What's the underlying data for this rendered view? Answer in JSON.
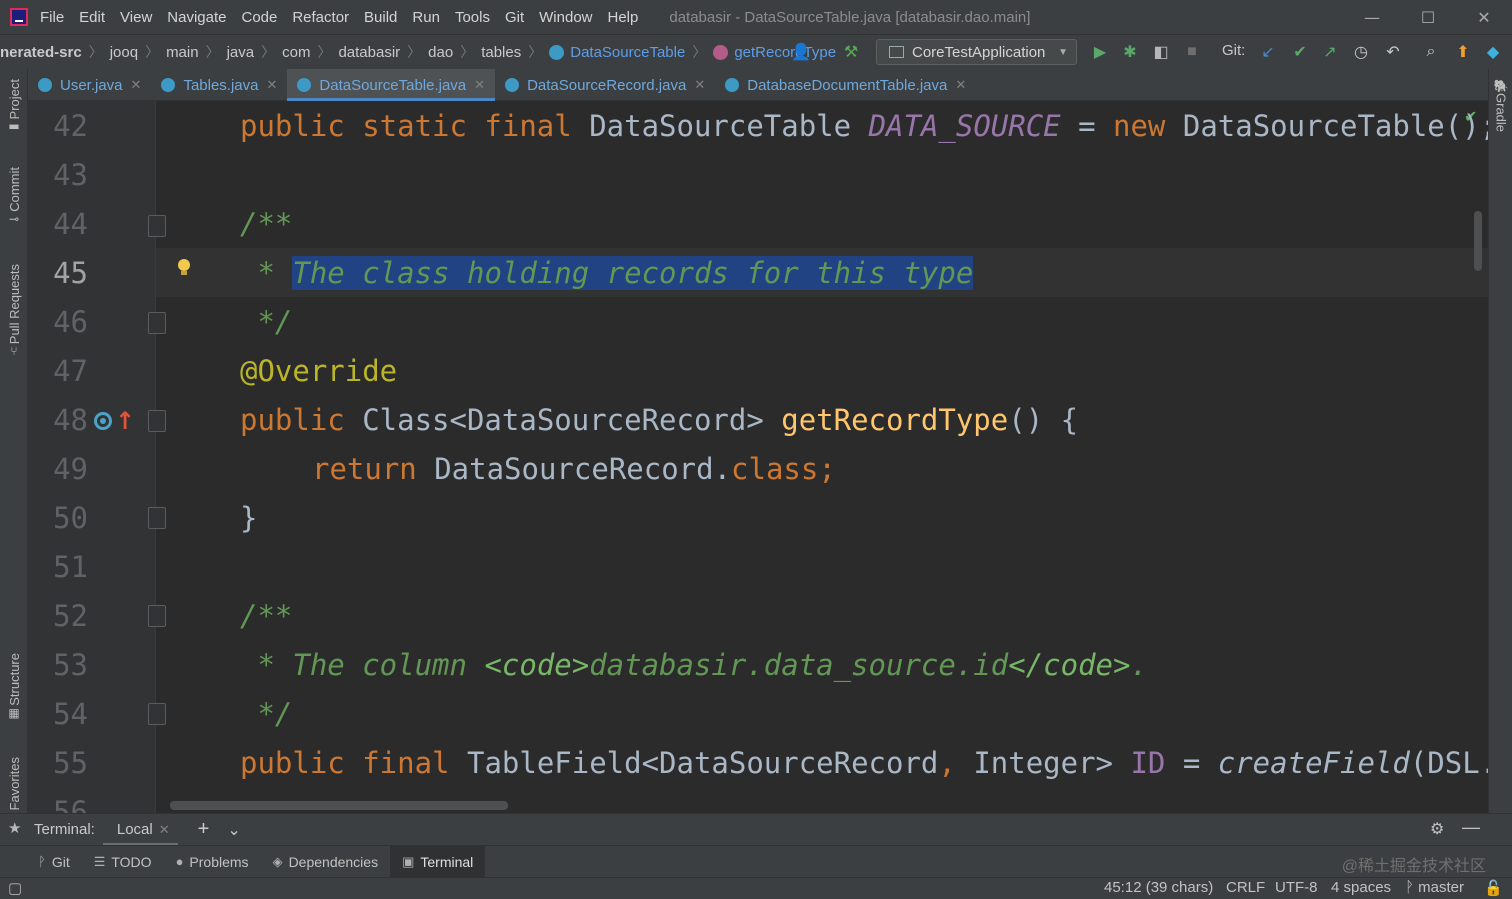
{
  "window": {
    "title": "databasir - DataSourceTable.java [databasir.dao.main]",
    "menu": [
      "File",
      "Edit",
      "View",
      "Navigate",
      "Code",
      "Refactor",
      "Build",
      "Run",
      "Tools",
      "Git",
      "Window",
      "Help"
    ],
    "controls": {
      "minimize": "—",
      "maximize": "☐",
      "close": "✕"
    }
  },
  "breadcrumb": {
    "items": [
      "nerated-src",
      "jooq",
      "main",
      "java",
      "com",
      "databasir",
      "dao",
      "tables"
    ],
    "class_name": "DataSourceTable",
    "method_name": "getRecordType"
  },
  "toolbar": {
    "run_config": "CoreTestApplication",
    "git_label": "Git:"
  },
  "tabs": [
    {
      "label": "User.java",
      "active": false
    },
    {
      "label": "Tables.java",
      "active": false
    },
    {
      "label": "DataSourceTable.java",
      "active": true
    },
    {
      "label": "DataSourceRecord.java",
      "active": false
    },
    {
      "label": "DatabaseDocumentTable.java",
      "active": false
    }
  ],
  "left_tools": [
    "Project",
    "Commit",
    "Pull Requests",
    "Structure",
    "Favorites"
  ],
  "right_tools": [
    "Gradle"
  ],
  "editor": {
    "line_numbers": [
      "42",
      "43",
      "44",
      "45",
      "46",
      "47",
      "48",
      "49",
      "50",
      "51",
      "52",
      "53",
      "54",
      "55",
      "56"
    ],
    "current_line": "45",
    "lines": {
      "l42": {
        "kw1": "public static final ",
        "type": "DataSourceTable ",
        "field": "DATA_SOURCE",
        "op": " = ",
        "kw2": "new ",
        "rest": "DataSourceTable();"
      },
      "l44": {
        "comment": "/**"
      },
      "l45": {
        "star": " * ",
        "selected": "The class holding records for this type"
      },
      "l46": {
        "comment": " */"
      },
      "l47": {
        "annotation": "@Override"
      },
      "l48": {
        "kw": "public ",
        "type": "Class<DataSourceRecord> ",
        "method": "getRecordType",
        "rest": "() {"
      },
      "l49": {
        "kw": "return ",
        "type": "DataSourceRecord.",
        "kw2": "class",
        "semi": ";"
      },
      "l50": {
        "text": "}"
      },
      "l52": {
        "comment": "/**"
      },
      "l53": {
        "star": " * The column ",
        "tag_open": "<code>",
        "tag_text": "databasir.data_source.id",
        "tag_close": "</code>",
        "end": "."
      },
      "l54": {
        "comment": " */"
      },
      "l55": {
        "kw": "public final ",
        "type": "TableField<DataSourceRecord",
        "comma": ", ",
        "type2": "Integer> ",
        "field": "ID",
        "op": " = ",
        "call": "createField",
        "rest": "(DSL.name(\"id\")"
      }
    }
  },
  "terminal": {
    "label": "Terminal:",
    "tab": "Local",
    "add": "+",
    "dropdown": "⌄"
  },
  "bottom_tools": [
    {
      "icon": "ᚹ",
      "label": "Git"
    },
    {
      "icon": "☰",
      "label": "TODO"
    },
    {
      "icon": "●",
      "label": "Problems"
    },
    {
      "icon": "◈",
      "label": "Dependencies"
    },
    {
      "icon": "▣",
      "label": "Terminal"
    }
  ],
  "watermark": "@稀土掘金技术社区",
  "status": {
    "position": "45:12 (39 chars)",
    "line_sep": "CRLF",
    "encoding": "UTF-8",
    "indent": "4 spaces",
    "branch": "master"
  },
  "colors": {
    "keyword": "#cc7832",
    "comment": "#629755",
    "annotation": "#bbb529",
    "method": "#ffc66d",
    "field": "#9876aa",
    "selection": "#214283"
  }
}
